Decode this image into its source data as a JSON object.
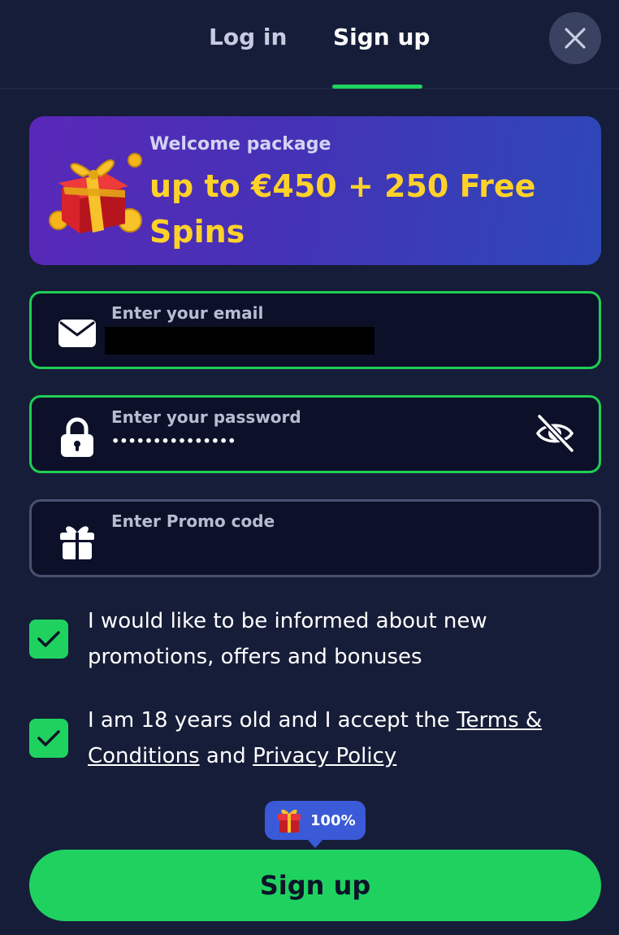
{
  "tabs": {
    "login_label": "Log in",
    "signup_label": "Sign up",
    "active": "signup"
  },
  "banner": {
    "subtitle": "Welcome package",
    "headline": "up to €450 + 250 Free Spins"
  },
  "fields": {
    "email": {
      "label": "Enter your email",
      "value": ""
    },
    "password": {
      "label": "Enter your password",
      "value": "•••••••••••••••"
    },
    "promo": {
      "label": "Enter Promo code",
      "value": ""
    }
  },
  "consents": {
    "promotions_text": "I would like to be informed about new promotions, offers and bonuses",
    "age_prefix": "I am 18 years old and I accept the ",
    "terms_link": "Terms & Conditions",
    "and_text": " and ",
    "privacy_link": "Privacy Policy"
  },
  "bonus_badge": {
    "percent": "100%"
  },
  "submit": {
    "label": "Sign up"
  },
  "colors": {
    "background": "#161d38",
    "accent_green": "#1fd260",
    "headline_yellow": "#ffd22a",
    "badge_blue": "#3a5ad8"
  },
  "icons": {
    "close": "close-icon",
    "email": "envelope-icon",
    "password": "lock-icon",
    "visibility": "eye-off-icon",
    "promo": "gift-icon",
    "check": "check-icon",
    "bonus": "gift-box-icon"
  }
}
